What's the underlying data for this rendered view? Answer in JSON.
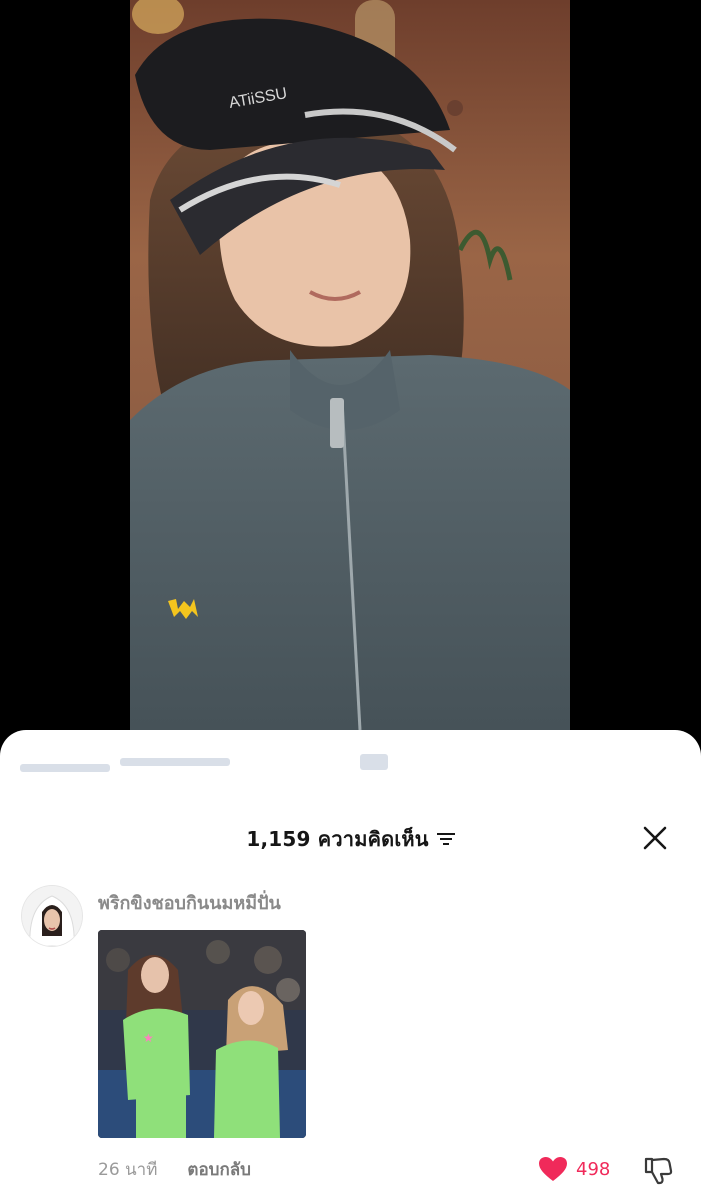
{
  "comments_header": {
    "count": "1,159",
    "title_suffix": "ความคิดเห็น",
    "title": "1,159 ความคิดเห็น"
  },
  "icons": {
    "sort": "sort-icon",
    "close": "close-icon",
    "like": "heart-icon",
    "dislike": "thumbs-down-icon"
  },
  "comment": {
    "username": "พริกขิงชอบกินนมหมีปั่น",
    "time": "26 นาที",
    "reply_label": "ตอบกลับ",
    "like_count": "498",
    "liked": true
  },
  "colors": {
    "like_accent": "#f02a5a",
    "sheet_background": "#ffffff",
    "sticker_yellow": "#f4c51e"
  }
}
